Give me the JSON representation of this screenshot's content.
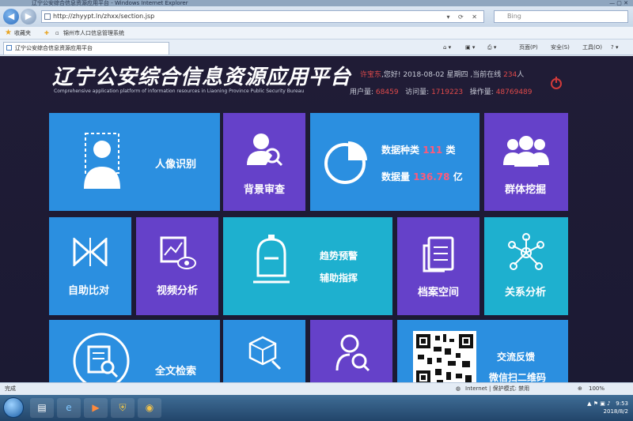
{
  "browser": {
    "window_title": "辽宁公安综合信息资源应用平台 - Windows Internet Explorer",
    "url": "http://zhyypt.ln/zhxx/section.jsp",
    "search_placeholder": "Bing",
    "favorites_label": "收藏夹",
    "favorite_link": "锦州市人口信息管理系统",
    "tab_title": "辽宁公安综合信息资源应用平台",
    "commands": [
      "页面(P)",
      "安全(S)",
      "工具(O)"
    ],
    "status_left": "完成",
    "status_zone": "Internet | 保护模式: 禁用",
    "zoom": "100%"
  },
  "header": {
    "title": "辽宁公安综合信息资源应用平台",
    "subtitle": "Comprehensive application platform of information resources in Liaoning Province Public Security Bureau",
    "user_prefix": "许宝东",
    "greeting": ",您好! 2018-08-02 星期四 ,当前在线 ",
    "online_count": "234",
    "online_unit": "人",
    "users_label": "用户量:",
    "users_value": "68459",
    "visits_label": "访问量:",
    "visits_value": "1719223",
    "ops_label": "操作量:",
    "ops_value": "48769489"
  },
  "tiles": {
    "face": "人像识别",
    "background": "背景审查",
    "data_kinds_label": "数据种类",
    "data_kinds_value": "111",
    "data_kinds_unit": "类",
    "data_volume_label": "数据量",
    "data_volume_value": "136.78",
    "data_volume_unit": "亿",
    "group": "群体挖掘",
    "compare": "自助比对",
    "video": "视频分析",
    "trend_line1": "趋势预警",
    "trend_line2": "辅助指挥",
    "archive": "档案空间",
    "relation": "关系分析",
    "fulltext": "全文检索",
    "feedback_line1": "交流反馈",
    "feedback_line2": "微信扫二维码"
  },
  "taskbar": {
    "time": "9:53",
    "date": "2018/8/2"
  },
  "colors": {
    "tile_blue": "#2b8fe0",
    "tile_purple": "#6541c9",
    "tile_cyan": "#1eb0cf",
    "highlight_red": "#e04a4a",
    "background": "#201c36"
  }
}
